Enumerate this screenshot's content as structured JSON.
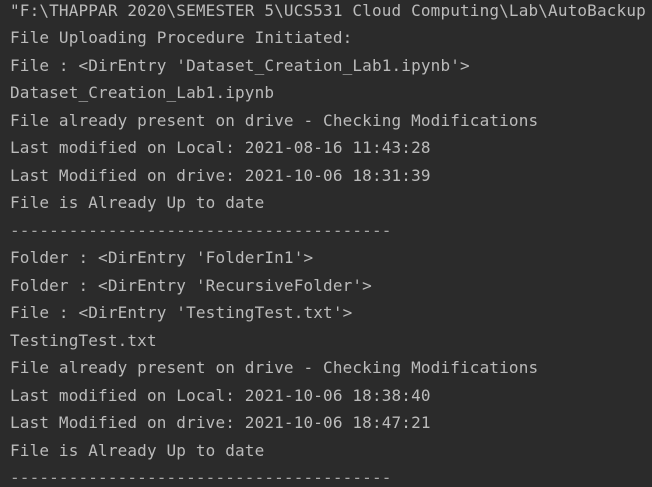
{
  "console": {
    "lines": [
      "\"F:\\THAPPAR 2020\\SEMESTER 5\\UCS531 Cloud Computing\\Lab\\AutoBackup",
      "File Uploading Procedure Initiated:",
      "File : <DirEntry 'Dataset_Creation_Lab1.ipynb'>",
      "Dataset_Creation_Lab1.ipynb",
      "File already present on drive - Checking Modifications",
      "Last modified on Local: 2021-08-16 11:43:28",
      "Last Modified on drive: 2021-10-06 18:31:39",
      "File is Already Up to date",
      "---------------------------------------",
      "Folder : <DirEntry 'FolderIn1'>",
      "Folder : <DirEntry 'RecursiveFolder'>",
      "File : <DirEntry 'TestingTest.txt'>",
      "TestingTest.txt",
      "File already present on drive - Checking Modifications",
      "Last modified on Local: 2021-10-06 18:38:40",
      "Last Modified on drive: 2021-10-06 18:47:21",
      "File is Already Up to date",
      "---------------------------------------"
    ]
  }
}
